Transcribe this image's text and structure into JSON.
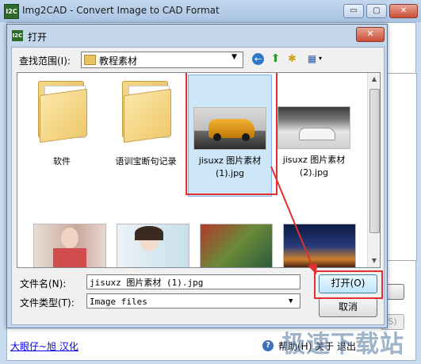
{
  "app": {
    "title": "Img2CAD - Convert Image to CAD Format",
    "logo_text": "I2C",
    "minimize_glyph": "▭",
    "maximize_glyph": "▢",
    "close_glyph": "✕",
    "footer_link": "大眼仔~旭 汉化",
    "help_text": "帮助(H)  关于 退出",
    "right_btn2_label": "S)",
    "watermark": "极速下载站"
  },
  "dialog": {
    "title": "打开",
    "logo_text": "I2C",
    "close_glyph": "✕",
    "look_in_label": "查找范围(I):",
    "look_in_value": "教程素材",
    "dropdown_glyph": "▼",
    "toolbar": {
      "back_glyph": "←",
      "up_glyph": "⬆",
      "new_folder_glyph": "✱",
      "view_glyph": "▦",
      "view_arrow": "▾"
    },
    "scroll_up_glyph": "▲",
    "scroll_down_glyph": "▼",
    "items": [
      {
        "label": "软件",
        "kind": "folder"
      },
      {
        "label": "语训宝断句记录",
        "kind": "folder"
      },
      {
        "label": "jisuxz 图片素材 (1).jpg",
        "kind": "image",
        "selected": true
      },
      {
        "label": "jisuxz 图片素材 (2).jpg",
        "kind": "image"
      }
    ],
    "file_name_label": "文件名(N):",
    "file_name_value": "jisuxz 图片素材 (1).jpg",
    "file_type_label": "文件类型(T):",
    "file_type_value": "Image files",
    "open_button": "打开(O)",
    "cancel_button": "取消"
  },
  "colors": {
    "highlight_red": "#e03030",
    "selection_blue": "#cde6f7"
  }
}
